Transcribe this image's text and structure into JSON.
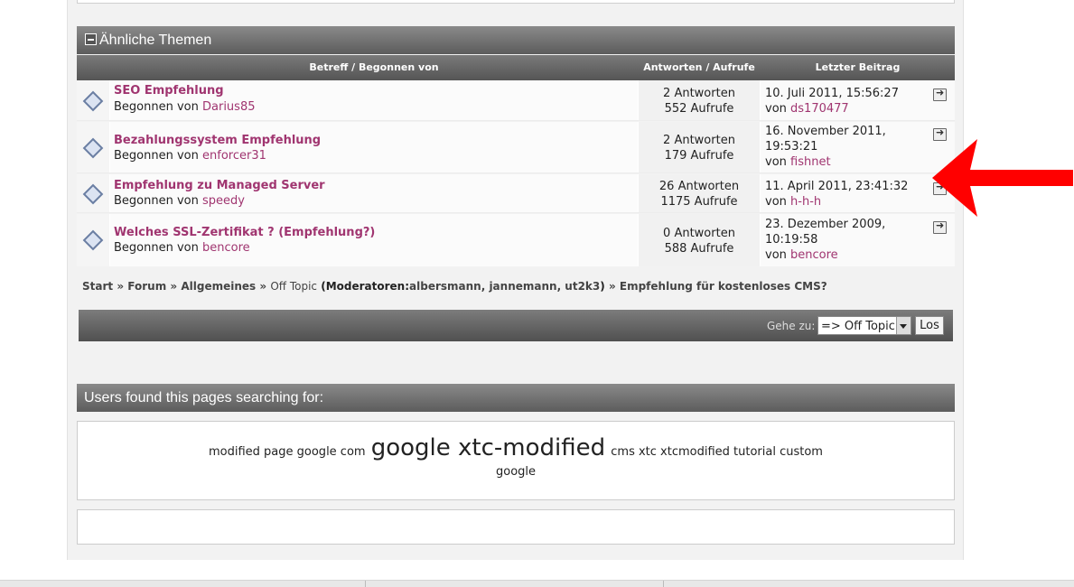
{
  "similar_threads": {
    "title": "Ähnliche Themen",
    "columns": {
      "subject": "Betreff / Begonnen von",
      "replies_views": "Antworten / Aufrufe",
      "last_post": "Letzter Beitrag"
    },
    "rows": [
      {
        "title": "SEO Empfehlung",
        "started_prefix": "Begonnen von",
        "author": "Darius85",
        "replies": "2 Antworten",
        "views": "552 Aufrufe",
        "last_date": "10. Juli 2011, 15:56:27",
        "last_prefix": "von",
        "last_user": "ds170477"
      },
      {
        "title": "Bezahlungssystem Empfehlung",
        "started_prefix": "Begonnen von",
        "author": "enforcer31",
        "replies": "2 Antworten",
        "views": "179 Aufrufe",
        "last_date": "16. November 2011, 19:53:21",
        "last_prefix": "von",
        "last_user": "fishnet"
      },
      {
        "title": "Empfehlung zu Managed Server",
        "started_prefix": "Begonnen von",
        "author": "speedy",
        "replies": "26 Antworten",
        "views": "1175 Aufrufe",
        "last_date": "11. April 2011, 23:41:32",
        "last_prefix": "von",
        "last_user": "h-h-h"
      },
      {
        "title": "Welches SSL-Zertifikat ? (Empfehlung?)",
        "started_prefix": "Begonnen von",
        "author": "bencore",
        "replies": "0 Antworten",
        "views": "588 Aufrufe",
        "last_date": "23. Dezember 2009, 10:19:58",
        "last_prefix": "von",
        "last_user": "bencore"
      }
    ]
  },
  "breadcrumb": {
    "start": "Start",
    "forum": "Forum",
    "general": "Allgemeines",
    "offtopic": "Off Topic",
    "moderators_prefix": "(Moderatoren:",
    "moderators": "albersmann, jannemann, ut2k3",
    "moderators_close": ")",
    "thread": "Empfehlung für kostenloses CMS?",
    "separator": "»"
  },
  "jump": {
    "label": "Gehe zu:",
    "selected": "=> Off Topic",
    "button": "Los"
  },
  "search_terms": {
    "title": "Users found this pages searching for:",
    "tags": [
      {
        "text": "modified page google com",
        "size": "small"
      },
      {
        "text": "google xtc-modified",
        "size": "large"
      },
      {
        "text": "cms xtc xtcmodified tutorial custom",
        "size": "small"
      },
      {
        "text": "google",
        "size": "small"
      }
    ]
  },
  "colors": {
    "link": "#a03570",
    "header_bg": "#6a6a6a",
    "arrow": "#ff0000"
  }
}
